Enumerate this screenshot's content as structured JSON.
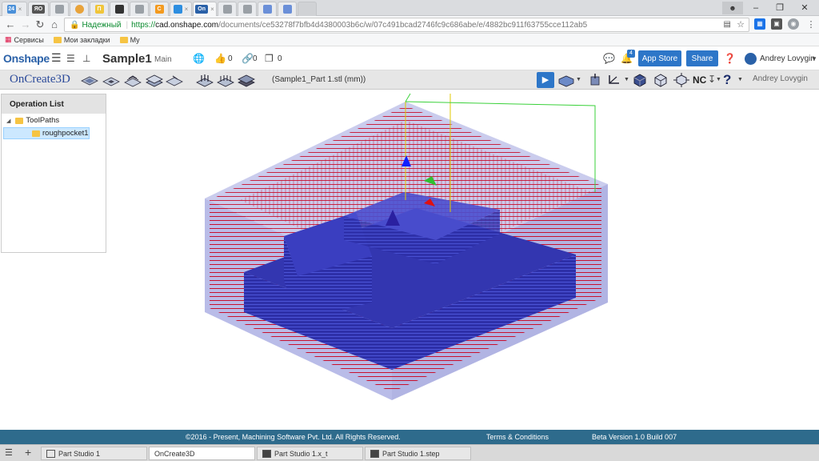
{
  "browser": {
    "tabs": [
      {
        "label": "24",
        "color": "#4a90d9"
      },
      {
        "label": "ЯО",
        "color": "#555555"
      },
      {
        "label": "",
        "color": "#9aa0a6"
      },
      {
        "label": "",
        "color": "#e8a33b"
      },
      {
        "label": "П",
        "color": "#f0c53a"
      },
      {
        "label": "",
        "color": "#333333"
      },
      {
        "label": "",
        "color": "#9aa0a6"
      },
      {
        "label": "С",
        "color": "#f39a1f"
      },
      {
        "label": "",
        "color": "#2d8ee0"
      },
      {
        "label": "On",
        "color": "#2a61a8",
        "active": true
      },
      {
        "label": "",
        "color": "#9aa0a6"
      },
      {
        "label": "",
        "color": "#9aa0a6"
      },
      {
        "label": "",
        "color": "#6a8fd8"
      },
      {
        "label": "",
        "color": "#6a8fd8"
      }
    ],
    "url_secure_label": "Надежный",
    "url_scheme": "https://",
    "url_host": "cad.onshape.com",
    "url_path": "/documents/ce53278f7bfb4d4380003b6c/w/07c491bcad2746fc9c686abe/e/4882bc911f63755cce112ab5",
    "bookmarks": [
      {
        "label": "Сервисы",
        "icon": "apps-icon"
      },
      {
        "label": "Мои закладки",
        "icon": "folder-icon"
      },
      {
        "label": "My",
        "icon": "folder-icon"
      }
    ]
  },
  "onshape": {
    "logo": "Onshape",
    "doc_title": "Sample1",
    "branch": "Main",
    "likes": "0",
    "links": "0",
    "copies": "0",
    "notifications": "4",
    "app_store": "App Store",
    "share": "Share",
    "user": "Andrey Lovygin"
  },
  "oncreate3d": {
    "logo": "OnCreate3D",
    "file_label": "(Sample1_Part 1.stl (mm))",
    "nc_label": "NC",
    "user": "Andrey Lovygin"
  },
  "panel": {
    "title": "Operation List",
    "root": "ToolPaths",
    "child": "roughpocket1"
  },
  "footer": {
    "copyright": "©2016 - Present, Machining Software Pvt. Ltd. All Rights Reserved.",
    "terms": "Terms & Conditions",
    "version": "Beta Version 1.0 Build 007"
  },
  "taskbar": {
    "tabs": [
      {
        "label": "Part Studio 1"
      },
      {
        "label": "OnCreate3D",
        "active": true
      },
      {
        "label": "Part Studio 1.x_t"
      },
      {
        "label": "Part Studio 1.step"
      }
    ]
  },
  "colors": {
    "accent": "#2d76c8",
    "footer": "#2e6b8c",
    "toolpath": "#c8102e",
    "part": "#2d2fa8",
    "stock": "#8a8fd8"
  }
}
